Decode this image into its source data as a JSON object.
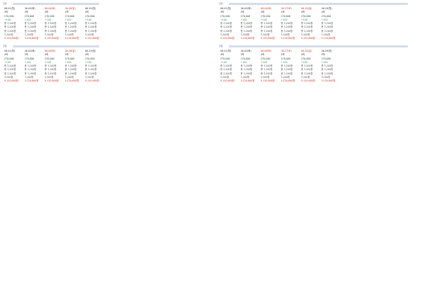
{
  "sections": [
    {
      "id": "s1",
      "title": "핫딜",
      "cols": [
        {
          "d": "06-01(월)",
          "d2": "4박",
          "p": "270,000",
          "g": "+100",
          "r1": "총 3,200원",
          "r2": "총 3,200원",
          "r3": "총 3,200원",
          "r4": "3,200원",
          "v": "9,120,600원"
        },
        {
          "d": "06-02(화)",
          "d2": "4박",
          "p": "270,000",
          "g": "+100",
          "r1": "총 3,200원",
          "r2": "총 3,200원",
          "r3": "총 3,200원",
          "r4": "3,200원",
          "v": "9,120,600원"
        },
        {
          "d": "06-06(토)",
          "d2": "4박",
          "p": "270,000",
          "g": "+100",
          "r1": "총 3,200원",
          "r2": "총 3,200원",
          "r3": "총 3,200원",
          "r4": "3,200원",
          "v": "9,120,600원",
          "w": true
        },
        {
          "d": "06-28(일)",
          "d2": "4박",
          "p": "270,000",
          "g": "+100",
          "r1": "총 3,200원",
          "r2": "총 3,200원",
          "r3": "총 3,200원",
          "r4": "3,200원",
          "v": "9,120,600원",
          "w": true
        },
        {
          "d": "06-29(월)",
          "d2": "4박",
          "p": "270,000",
          "g": "+100",
          "r1": "총 3,200원",
          "r2": "총 3,200원",
          "r3": "총 3,200원",
          "r4": "3,200원",
          "v": "9,120,600원"
        }
      ]
    },
    {
      "id": "s2",
      "title": "핫딜",
      "cols": [
        {
          "d": "06-01(월)",
          "d2": "4박",
          "p": "270,000",
          "g": "+100",
          "r1": "총 3,200원",
          "r2": "총 3,200원",
          "r3": "총 3,200원",
          "r4": "3,200원",
          "v": "9,120,600원"
        },
        {
          "d": "06-02(화)",
          "d2": "4박",
          "p": "270,000",
          "g": "+100",
          "r1": "총 3,200원",
          "r2": "총 3,200원",
          "r3": "총 3,200원",
          "r4": "3,200원",
          "v": "9,120,600원"
        },
        {
          "d": "06-06(토)",
          "d2": "4박",
          "p": "270,000",
          "g": "+100",
          "r1": "총 3,200원",
          "r2": "총 3,200원",
          "r3": "총 3,200원",
          "r4": "3,200원",
          "v": "9,120,600원",
          "w": true
        },
        {
          "d": "06-27(토)",
          "d2": "4박",
          "p": "270,000",
          "g": "+100",
          "r1": "총 3,200원",
          "r2": "총 3,200원",
          "r3": "총 3,200원",
          "r4": "3,200원",
          "v": "9,120,600원",
          "w": true
        },
        {
          "d": "06-28(일)",
          "d2": "4박",
          "p": "270,000",
          "g": "+100",
          "r1": "총 3,200원",
          "r2": "총 3,200원",
          "r3": "총 3,200원",
          "r4": "3,200원",
          "v": "9,120,600원",
          "w": true
        },
        {
          "d": "06-29(월)",
          "d2": "4박",
          "p": "270,000",
          "g": "+100",
          "r1": "총 3,200원",
          "r2": "총 3,200원",
          "r3": "총 3,200원",
          "r4": "3,200원",
          "v": "9,120,600원"
        }
      ]
    }
  ]
}
